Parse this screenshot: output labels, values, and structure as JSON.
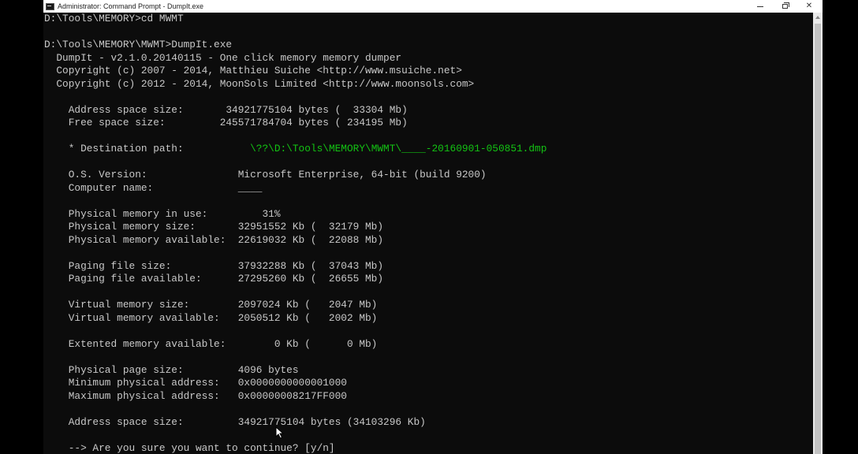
{
  "window": {
    "title": "Administrator: Command Prompt - DumpIt.exe"
  },
  "console": {
    "lines": [
      {
        "text": "D:\\Tools\\MEMORY>cd MWMT"
      },
      {
        "text": ""
      },
      {
        "text": "D:\\Tools\\MEMORY\\MWMT>DumpIt.exe"
      },
      {
        "text": "  DumpIt - v2.1.0.20140115 - One click memory memory dumper"
      },
      {
        "text": "  Copyright (c) 2007 - 2014, Matthieu Suiche <http://www.msuiche.net>"
      },
      {
        "text": "  Copyright (c) 2012 - 2014, MoonSols Limited <http://www.moonsols.com>"
      },
      {
        "text": ""
      },
      {
        "text": "    Address space size:       34921775104 bytes (  33304 Mb)"
      },
      {
        "text": "    Free space size:         245571784704 bytes ( 234195 Mb)"
      },
      {
        "text": ""
      },
      {
        "text": "    * Destination path:           ",
        "highlight": "\\??\\D:\\Tools\\MEMORY\\MWMT\\____-20160901-050851.dmp"
      },
      {
        "text": ""
      },
      {
        "text": "    O.S. Version:               Microsoft Enterprise, 64-bit (build 9200)"
      },
      {
        "text": "    Computer name:              ____"
      },
      {
        "text": ""
      },
      {
        "text": "    Physical memory in use:         31%"
      },
      {
        "text": "    Physical memory size:       32951552 Kb (  32179 Mb)"
      },
      {
        "text": "    Physical memory available:  22619032 Kb (  22088 Mb)"
      },
      {
        "text": ""
      },
      {
        "text": "    Paging file size:           37932288 Kb (  37043 Mb)"
      },
      {
        "text": "    Paging file available:      27295260 Kb (  26655 Mb)"
      },
      {
        "text": ""
      },
      {
        "text": "    Virtual memory size:        2097024 Kb (   2047 Mb)"
      },
      {
        "text": "    Virtual memory available:   2050512 Kb (   2002 Mb)"
      },
      {
        "text": ""
      },
      {
        "text": "    Extented memory available:        0 Kb (      0 Mb)"
      },
      {
        "text": ""
      },
      {
        "text": "    Physical page size:         4096 bytes"
      },
      {
        "text": "    Minimum physical address:   0x0000000000001000"
      },
      {
        "text": "    Maximum physical address:   0x00000008217FF000"
      },
      {
        "text": ""
      },
      {
        "text": "    Address space size:         34921775104 bytes (34103296 Kb)"
      },
      {
        "text": ""
      },
      {
        "text": "    --> Are you sure you want to continue? [y/n]"
      }
    ]
  },
  "colors": {
    "text": "#c8c8c8",
    "highlight": "#13c313",
    "background": "#0c0c0c"
  },
  "icons": {
    "app": "cmd-icon",
    "minimize": "minimize-icon",
    "maximize": "restore-icon",
    "close": "close-icon",
    "pointer": "mouse-pointer-icon"
  }
}
